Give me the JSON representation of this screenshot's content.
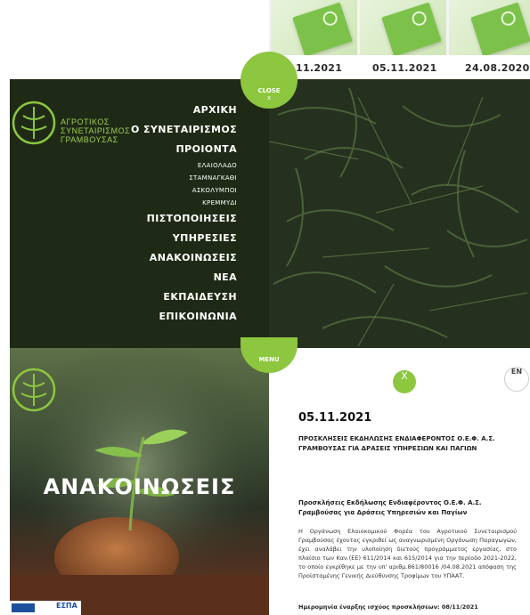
{
  "dates": [
    "11.2021",
    "05.11.2021",
    "24.08.2020"
  ],
  "close_button": {
    "label": "CLOSE",
    "icon": "x"
  },
  "menu_button": {
    "label": "MENU"
  },
  "logo": {
    "line1": "ΑΓΡΟΤΙΚΟΣ",
    "line2": "ΣΥΝΕΤΑΙΡΙΣΜΟΣ",
    "line3": "ΓΡΑΜΒΟΥΣΑΣ",
    "year_top": "19",
    "year_bottom": "28"
  },
  "nav": {
    "home": "ΑΡΧΙΚΗ",
    "cooperative": "Ο ΣΥΝΕΤΑΙΡΙΣΜΟΣ",
    "products": "ΠΡΟΙΟΝΤΑ",
    "sub": [
      "ΕΛΑΙΟΛΑΔΟ",
      "ΣΤΑΜΝΑΓΚΑΘΙ",
      "ΑΣΚΟΛΥΜΠΟΙ",
      "ΚΡΕΜΜΥΔΙ"
    ],
    "certifications": "ΠΙΣΤΟΠΟΙΗΣΕΙΣ",
    "services": "ΥΠΗΡΕΣΙΕΣ",
    "announcements": "ΑΝΑΚΟΙΝΩΣΕΙΣ",
    "news": "ΝΕΑ",
    "training": "ΕΚΠΑΙΔΕΥΣΗ",
    "contact": "ΕΠΙΚΟΙΝΩΝΙΑ"
  },
  "hero_title": "ΑΝΑΚΟΙΝΩΣΕΙΣ",
  "espa_label": "ΕΣΠΑ",
  "x_button": "X",
  "lang_button": "EN",
  "article": {
    "date": "05.11.2021",
    "title": "ΠΡΟΣΚΛΗΣΕΙΣ ΕΚΔΗΛΩΣΗΣ ΕΝΔΙΑΦΕΡΟΝΤΟΣ Ο.Ε.Φ. Α.Σ. ΓΡΑΜΒΟΥΣΑΣ ΓΙΑ ΔΡΑΣΕΙΣ ΥΠΗΡΕΣΙΩΝ ΚΑΙ ΠΑΓΙΩΝ",
    "subtitle": "Προσκλήσεις Εκδήλωσης Ενδιαφέροντος Ο.Ε.Φ. Α.Σ. Γραμβούσας για Δράσεις Υπηρεσιών και Παγίων",
    "body": "Η Οργάνωση Ελαιοκομικού Φορέα του Αγροτικού Συνεταιρισμού Γραμβούσας έχοντας εγκριθεί ως αναγνωρισμένη Οργάνωση Παραγωγών, έχει αναλάβει την υλοποίηση διετούς προγράμματος εργασίας, στο πλαίσιο των Καν.(ΕΕ) 611/2014 και 615/2014 για την περίοδο 2021-2022, το οποίο εγκρίθηκε με την υπ' αριθμ.861/80016 /04.08.2021 απόφαση της Προϊσταμένης Γενικής Διεύθυνσης Τροφίμων του ΥΠΑΑΤ.",
    "start": "Ημερομηνία έναρξης ισχύος προσκλήσεων: 08/11/2021"
  }
}
